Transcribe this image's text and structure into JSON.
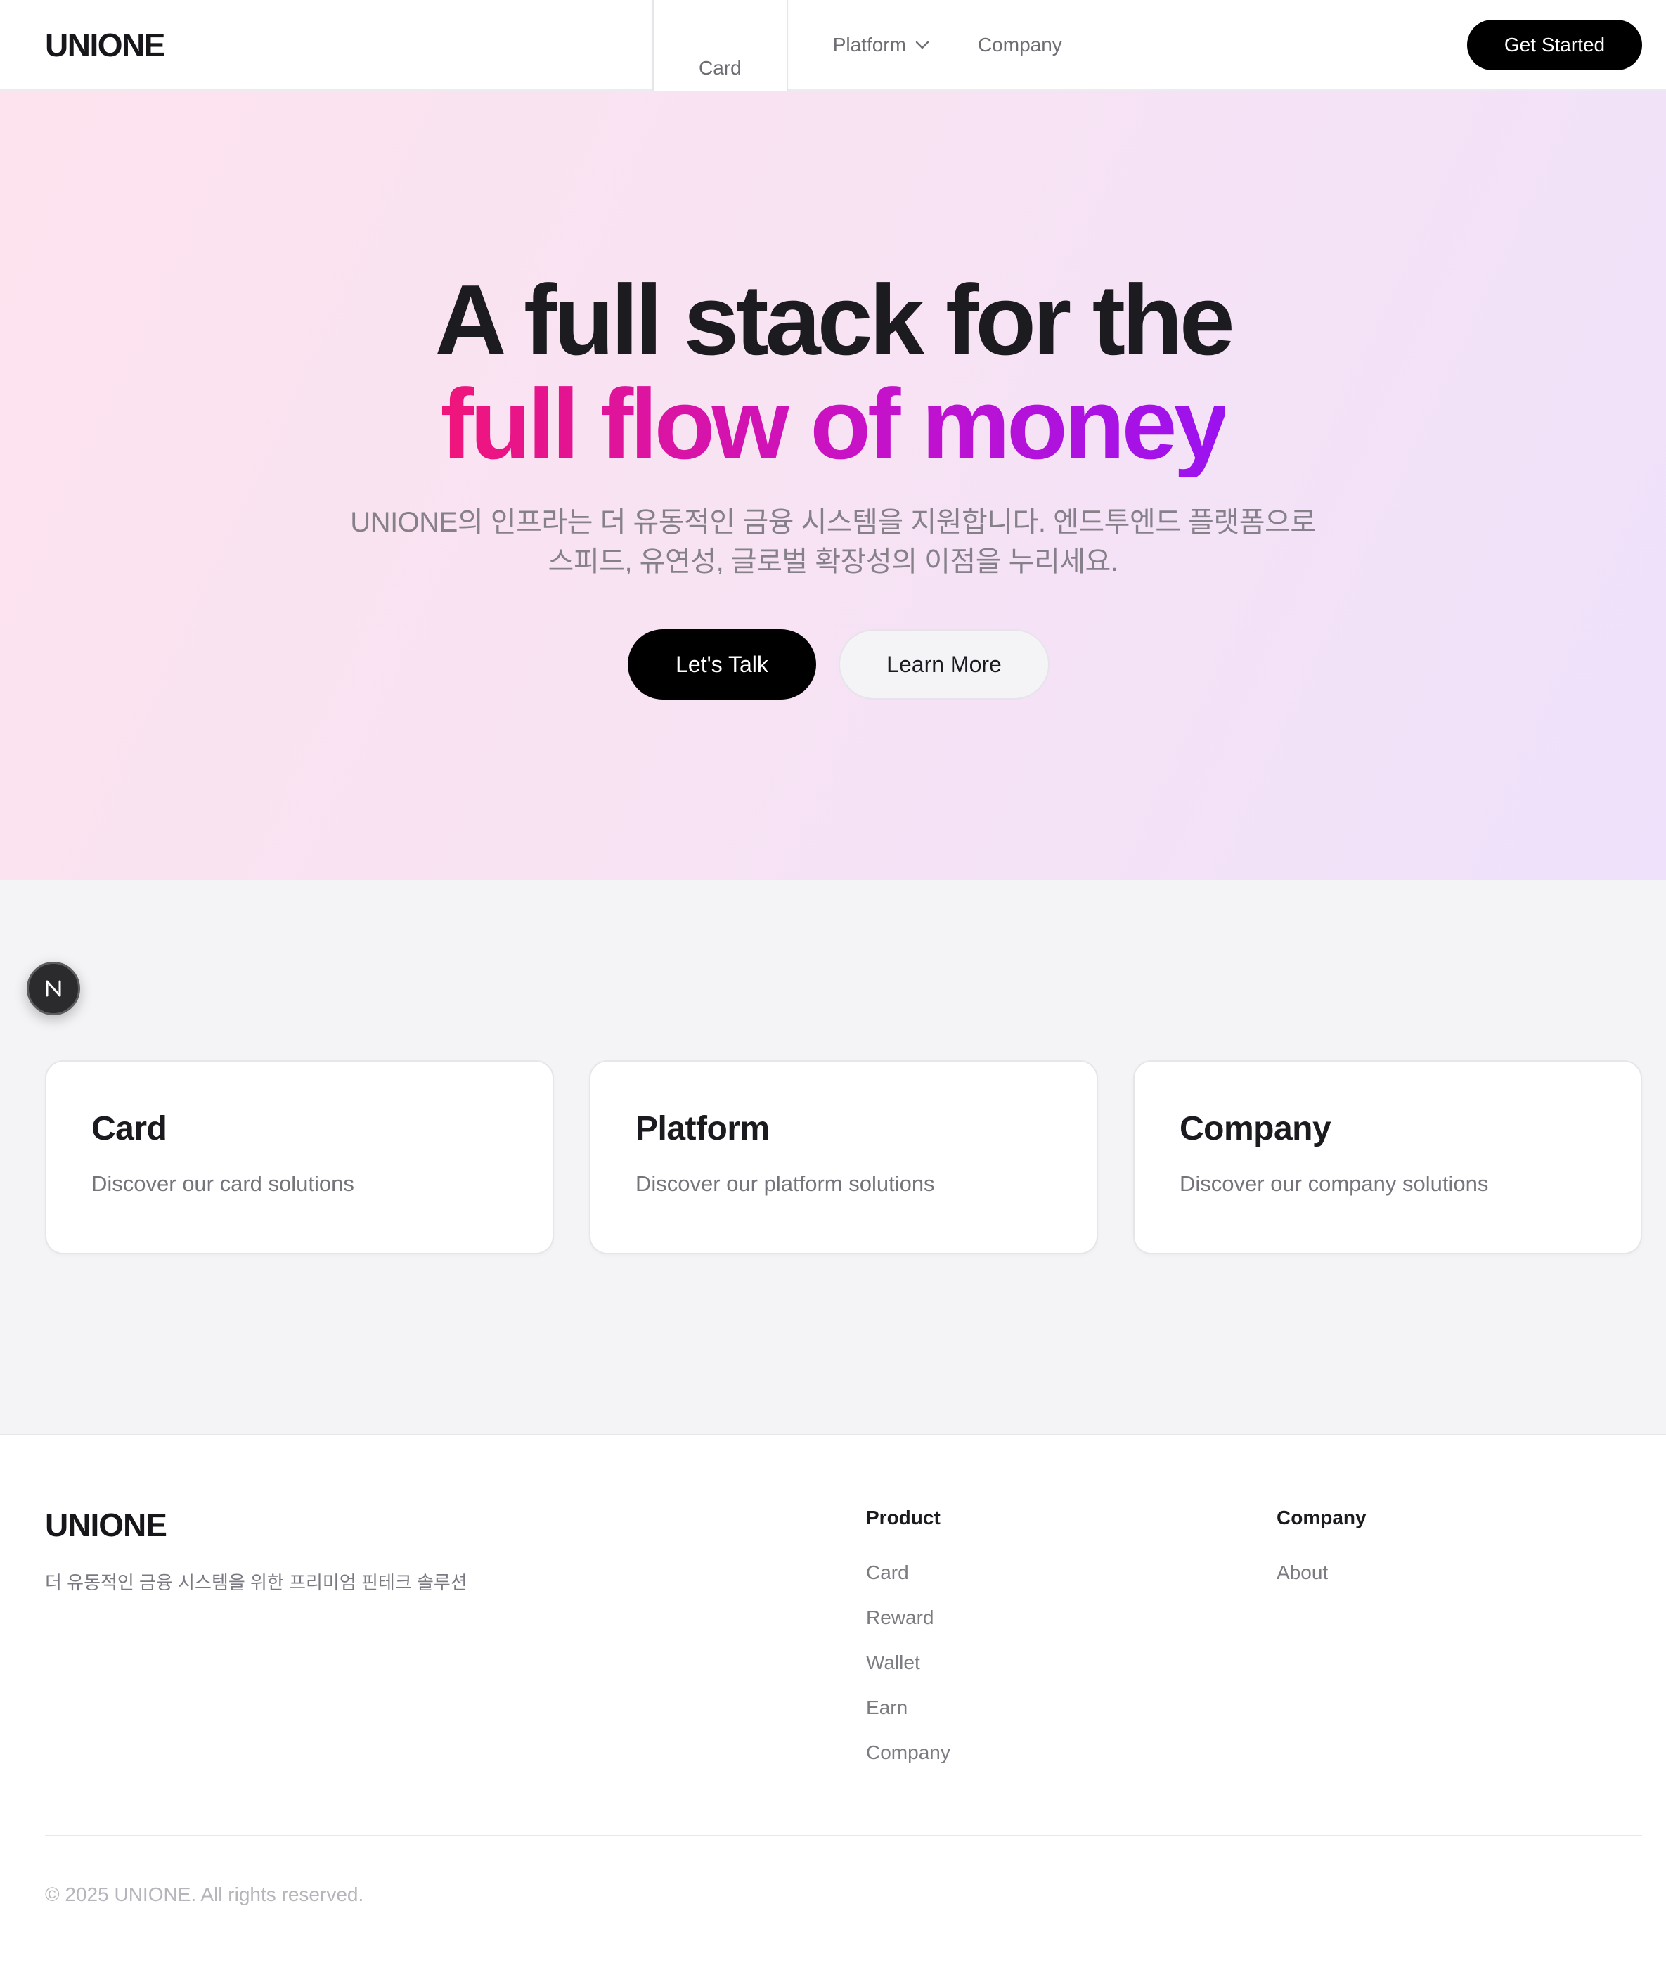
{
  "header": {
    "logo": "UNIONE",
    "nav": [
      {
        "label": "Card"
      },
      {
        "label": "Platform",
        "has_dropdown": true
      },
      {
        "label": "Company"
      }
    ],
    "cta_label": "Get Started"
  },
  "hero": {
    "title_line1": "A full stack for the",
    "title_line2": "full flow of money",
    "subtitle_line1": "UNIONE의 인프라는 더 유동적인 금융 시스템을 지원합니다. 엔드투엔드 플랫폼으로",
    "subtitle_line2": "스피드, 유연성, 글로벌 확장성의 이점을 누리세요.",
    "primary_button": "Let's Talk",
    "secondary_button": "Learn More",
    "gradient_colors": [
      "#f0157a",
      "#c612c9",
      "#9b12f0"
    ]
  },
  "badge": {
    "letter": "N"
  },
  "cards": [
    {
      "title": "Card",
      "description": "Discover our card solutions"
    },
    {
      "title": "Platform",
      "description": "Discover our platform solutions"
    },
    {
      "title": "Company",
      "description": "Discover our company solutions"
    }
  ],
  "footer": {
    "logo": "UNIONE",
    "tagline": "더 유동적인 금융 시스템을 위한 프리미엄 핀테크 솔루션",
    "columns": [
      {
        "heading": "Product",
        "links": [
          "Card",
          "Reward",
          "Wallet",
          "Earn",
          "Company"
        ]
      },
      {
        "heading": "Company",
        "links": [
          "About"
        ]
      }
    ],
    "copyright": "© 2025 UNIONE. All rights reserved."
  }
}
